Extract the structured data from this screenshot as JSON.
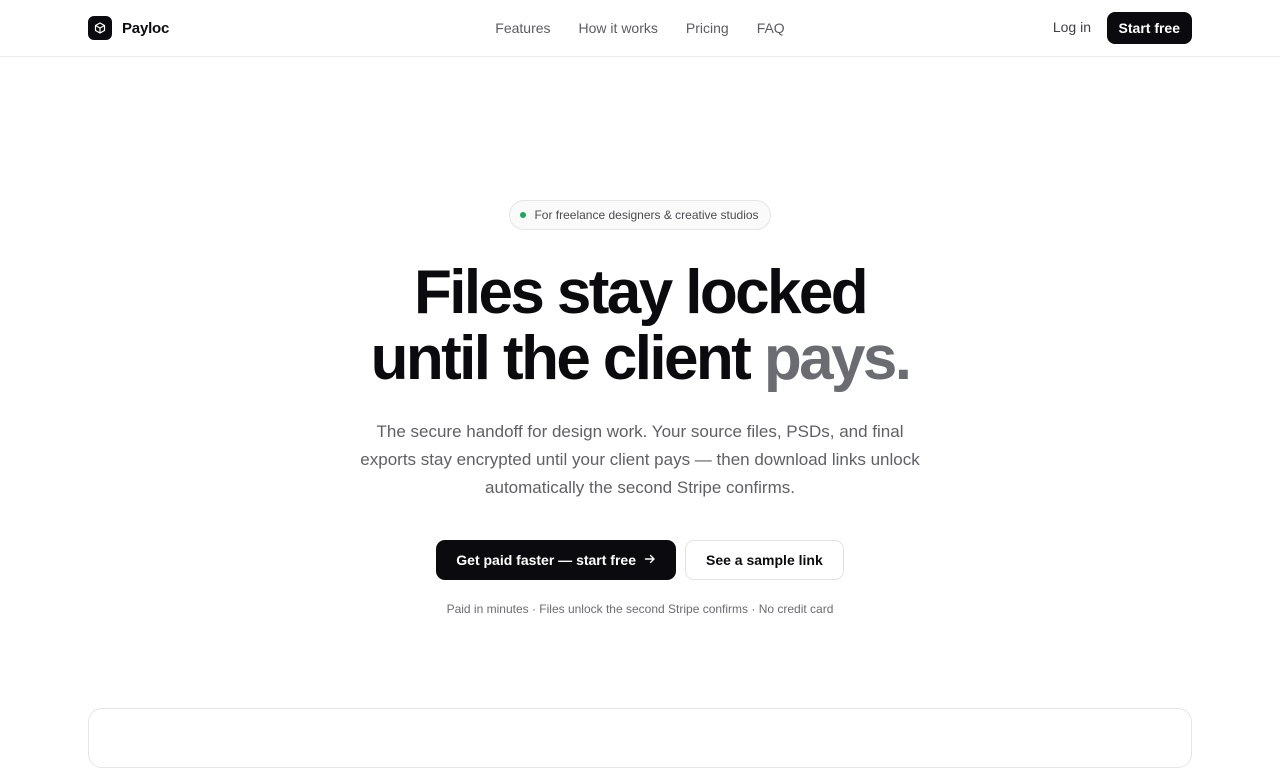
{
  "brand": {
    "name": "Payloc",
    "logo_icon": "cube-icon"
  },
  "nav": {
    "items": [
      {
        "label": "Features"
      },
      {
        "label": "How it works"
      },
      {
        "label": "Pricing"
      },
      {
        "label": "FAQ"
      }
    ]
  },
  "header": {
    "login_label": "Log in",
    "start_label": "Start free"
  },
  "hero": {
    "badge": "For freelance designers & creative studios",
    "headline_line1": "Files stay locked",
    "headline_line2_main": "until the client",
    "headline_line2_accent": "pays.",
    "subtext": "The secure handoff for design work. Your source files, PSDs, and final exports stay encrypted until your client pays — then download links unlock automatically the second Stripe confirms.",
    "cta_primary": "Get paid faster — start free",
    "cta_secondary": "See a sample link",
    "fineprint": "Paid in minutes · Files unlock the second Stripe confirms · No credit card"
  },
  "colors": {
    "primary": "#0b0b0f",
    "muted_text": "#6b6b72",
    "status_dot": "#22a55a",
    "border": "#e6e6ea"
  }
}
